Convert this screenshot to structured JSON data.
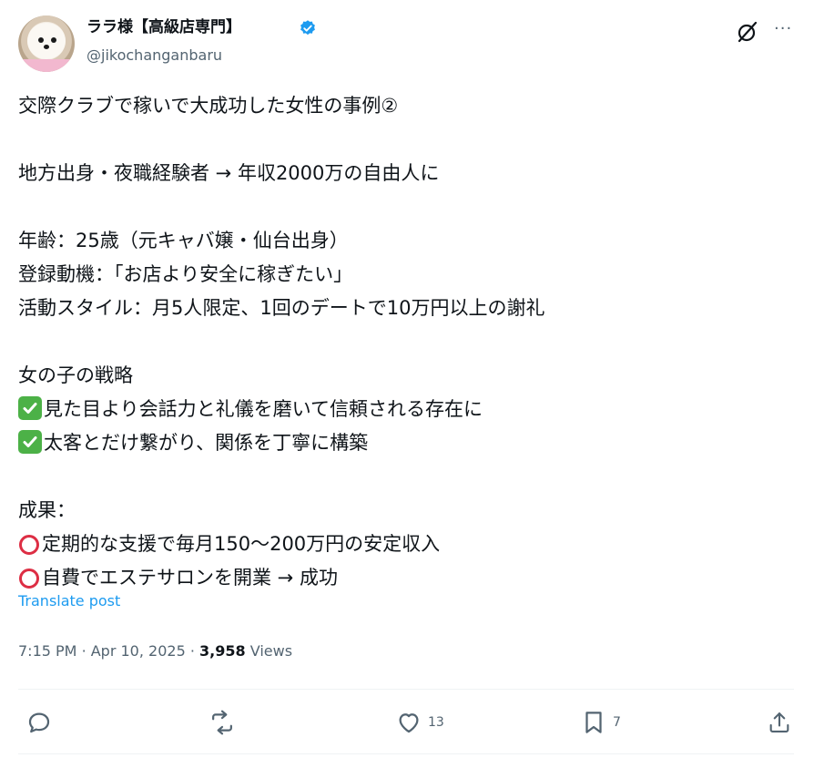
{
  "author": {
    "display_name": "ララ様【高級店専門】",
    "handle": "@jikochanganbaru",
    "verified": true
  },
  "post": {
    "lines": [
      "交際クラブで稼いで大成功した女性の事例②",
      "",
      "地方出身・夜職経験者 → 年収2000万の自由人に",
      "",
      "年齢：25歳（元キャバ嬢・仙台出身）",
      "登録動機：「お店より安全に稼ぎたい」",
      "活動スタイル：月5人限定、1回のデートで10万円以上の謝礼",
      "",
      "女の子の戦略",
      "見た目より会話力と礼儀を磨いて信頼される存在に",
      "太客とだけ繋がり、関係を丁寧に構築",
      "",
      "成果：",
      "定期的な支援で毎月150〜200万円の安定収入",
      "自費でエステサロンを開業 → 成功"
    ],
    "translate_label": "Translate post",
    "time": "7:15 PM",
    "date": "Apr 10, 2025",
    "views_count": "3,958",
    "views_label": "Views"
  },
  "actions": {
    "reply_count": "",
    "repost_count": "",
    "like_count": "13",
    "bookmark_count": "7"
  },
  "colors": {
    "accent": "#1d9bf0",
    "secondary_text": "#536471",
    "check_emoji": "#4cb147",
    "circle_emoji": "#dd2e44"
  }
}
